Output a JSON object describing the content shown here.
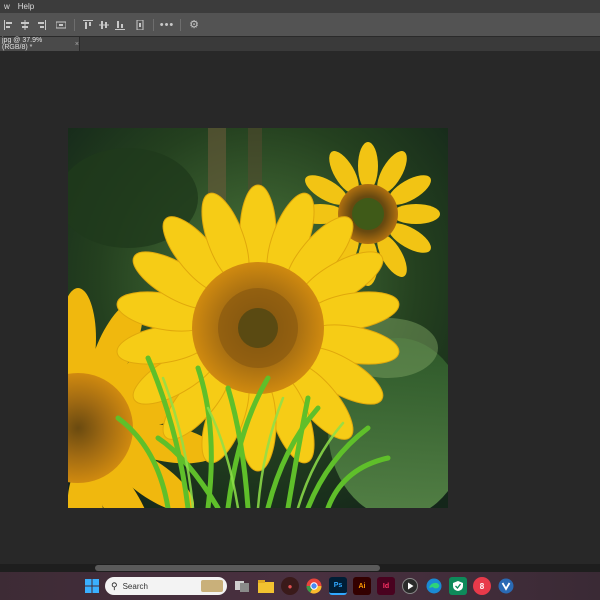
{
  "menu": {
    "items": [
      "w",
      "Help"
    ]
  },
  "document_tab": {
    "title": "jpg @ 37.9% (RGB/8) *",
    "close": "×"
  },
  "taskbar": {
    "search_placeholder": "Search"
  },
  "colors": {
    "canvas_bg": "#282828",
    "toolbar_bg": "#535353",
    "menubar_bg": "#3c3c3c",
    "taskbar_bg": "#4a3040"
  },
  "icons": {
    "options_bar": [
      "align-left-icon",
      "align-hcenter-icon",
      "align-right-icon",
      "distribute-icon",
      "align-top-icon",
      "align-vcenter-icon",
      "align-bottom-icon",
      "more-icon",
      "gear-icon"
    ],
    "taskbar": [
      "windows-start-icon",
      "search-icon",
      "task-view-icon",
      "file-explorer-icon",
      "app-icon",
      "chrome-icon",
      "photoshop-icon",
      "illustrator-icon",
      "indesign-icon",
      "media-player-icon",
      "edge-icon",
      "security-icon",
      "app-badge-icon",
      "v-app-icon"
    ]
  }
}
